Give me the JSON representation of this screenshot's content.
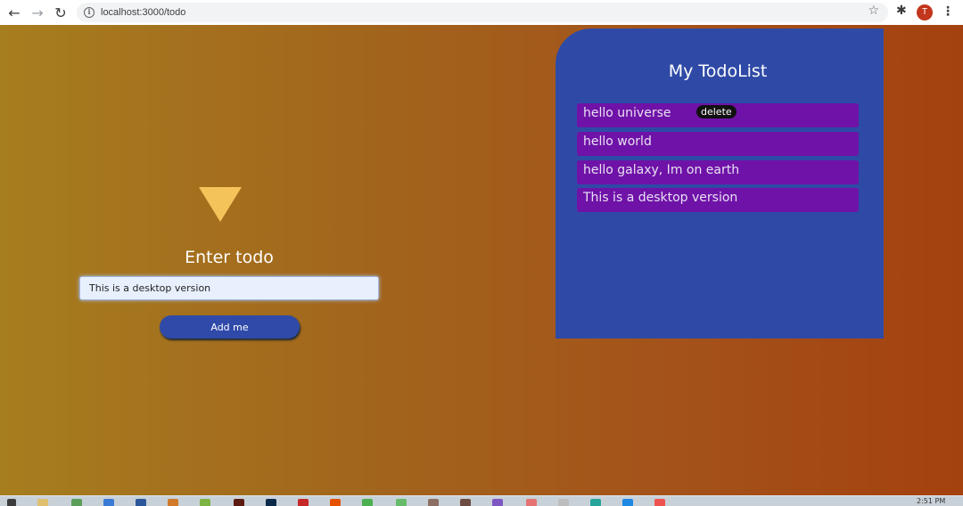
{
  "browser": {
    "url": "localhost:3000/todo",
    "avatar_initial": "T",
    "icons": [
      "back-arrow-icon",
      "forward-arrow-icon",
      "reload-icon",
      "info-icon",
      "star-icon",
      "extensions-icon",
      "menu-icon"
    ]
  },
  "form": {
    "title": "Enter todo",
    "input_value": "This is a desktop version",
    "button_label": "Add me",
    "triangle_color": "#f4c35a"
  },
  "todo_list": {
    "title": "My TodoList",
    "items": [
      {
        "text": "hello universe",
        "badge": "delete"
      },
      {
        "text": "hello world"
      },
      {
        "text": "hello galaxy, Im on earth"
      },
      {
        "text": "This is a desktop version"
      }
    ],
    "panel_color": "#2f4aa6",
    "item_color": "#6f12a8"
  },
  "taskbar": {
    "clock": "2:51 PM"
  }
}
